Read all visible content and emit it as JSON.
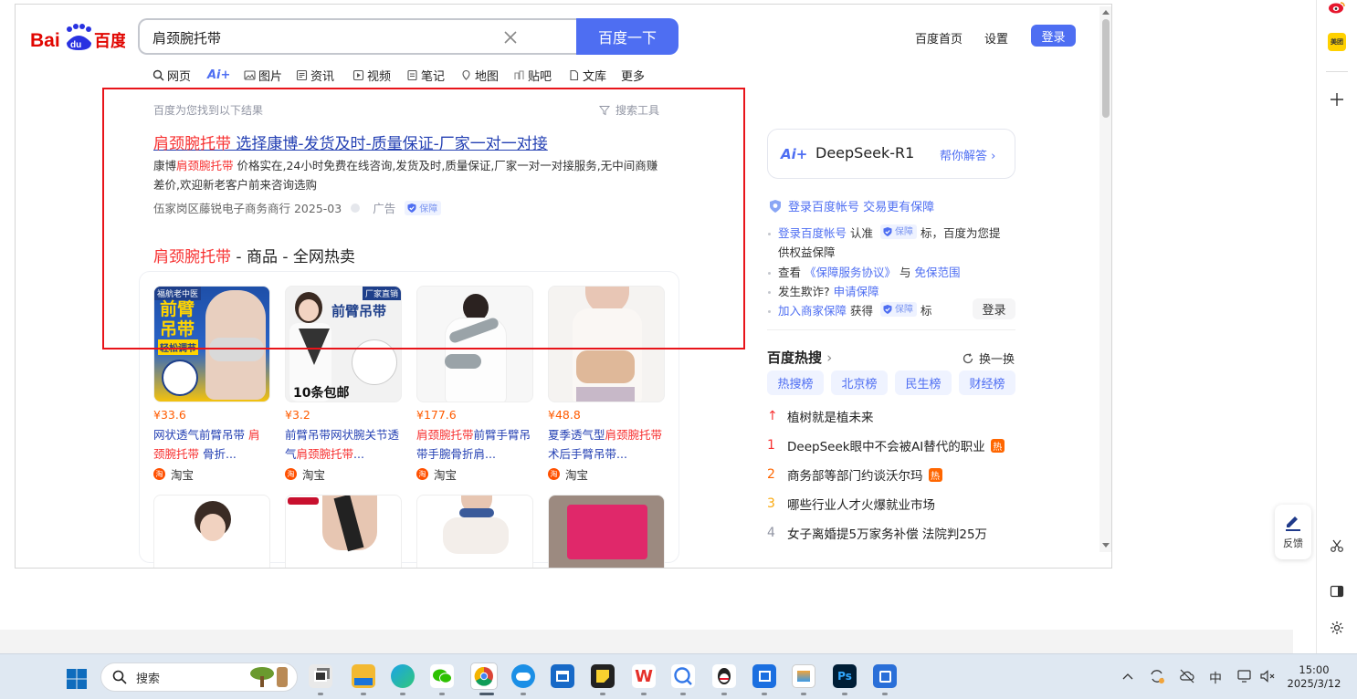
{
  "logo": {
    "text": "Bai",
    "du": "du",
    "cn": "百度"
  },
  "search": {
    "query": "肩颈腕托带",
    "button": "百度一下"
  },
  "header": {
    "home": "百度首页",
    "settings": "设置",
    "login": "登录"
  },
  "tabs": [
    {
      "label": "网页"
    },
    {
      "label": "Ai+"
    },
    {
      "label": "图片"
    },
    {
      "label": "资讯"
    },
    {
      "label": "视频"
    },
    {
      "label": "笔记"
    },
    {
      "label": "地图"
    },
    {
      "label": "贴吧"
    },
    {
      "label": "文库"
    },
    {
      "label": "更多"
    }
  ],
  "results": {
    "count_text": "百度为您找到以下结果",
    "tools": "搜索工具",
    "ad": {
      "title_highlight": "肩颈腕托带",
      "title_rest": " 选择康博-发货及时-质量保证-厂家一对一对接",
      "desc_pre": "康博",
      "desc_highlight": "肩颈腕托带",
      "desc_rest": " 价格实在,24小时免费在线咨询,发货及时,质量保证,厂家一对一对接服务,无中间商赚差价,欢迎新老客户前来咨询选购",
      "source": "伍家岗区藤锐电子商务商行 2025-03",
      "ad_label": "广告",
      "badge": "保障"
    },
    "shop": {
      "title_highlight": "肩颈腕托带",
      "title_rest": " - 商品 - 全网热卖",
      "products": [
        {
          "price": "¥33.6",
          "name_pre": "网状透气前臂吊带 ",
          "name_hl": "肩颈腕托带",
          "name_post": " 骨折...",
          "source": "淘宝",
          "img_text": "前臂\n吊带",
          "img_top": "福航老中医",
          "img_bottom": "轻松调节"
        },
        {
          "price": "¥3.2",
          "name_pre": "前臂吊带网状腕关节透气",
          "name_hl": "肩颈腕托带",
          "name_post": "...",
          "source": "淘宝",
          "img_text": "前臂吊带",
          "img_top": "厂家直销",
          "img_bottom": "10条包邮"
        },
        {
          "price": "¥177.6",
          "name_pre": "",
          "name_hl": "肩颈腕托带",
          "name_post": "前臂手臂吊带手腕骨折肩...",
          "source": "淘宝"
        },
        {
          "price": "¥48.8",
          "name_pre": "夏季透气型",
          "name_hl": "肩颈腕托带",
          "name_post": "术后手臂吊带...",
          "source": "淘宝"
        }
      ]
    }
  },
  "right": {
    "deepseek": {
      "logo": "Ai+",
      "name": "DeepSeek-R1",
      "help": "帮你解答"
    },
    "bao": {
      "head": "登录百度帐号 交易更有保障",
      "line1_blue": "登录百度帐号",
      "line1_mid": " 认准 ",
      "line1_badge": "保障",
      "line1_rest": " 标，百度为您提",
      "line1b": "供权益保障",
      "line2_pre": "查看 ",
      "line2_blue": "《保障服务协议》",
      "line2_mid": " 与 ",
      "line2_blue2": "免保范围",
      "line3_pre": "发生欺诈? ",
      "line3_blue": "申请保障",
      "line4_blue": "加入商家保障",
      "line4_mid": " 获得 ",
      "line4_badge": "保障",
      "line4_rest": " 标",
      "login": "登录"
    },
    "hot": {
      "title": "百度热搜",
      "refresh": "换一换",
      "tabs": [
        "热搜榜",
        "北京榜",
        "民生榜",
        "财经榜"
      ],
      "items": [
        {
          "rank": "↑",
          "text": "植树就是植未来",
          "tag": ""
        },
        {
          "rank": "1",
          "text": "DeepSeek眼中不会被AI替代的职业",
          "tag": "热"
        },
        {
          "rank": "2",
          "text": "商务部等部门约谈沃尔玛",
          "tag": "热"
        },
        {
          "rank": "3",
          "text": "哪些行业人才火爆就业市场",
          "tag": ""
        },
        {
          "rank": "4",
          "text": "女子离婚提5万家务补偿 法院判25万",
          "tag": ""
        }
      ]
    }
  },
  "feedback": "反馈",
  "taskbar": {
    "search": "搜索",
    "time": "15:00",
    "date": "2025/3/12",
    "ime": "中"
  },
  "colors": {
    "accent": "#4e6ef2",
    "highlight": "#f73131",
    "price": "#ff5b00",
    "ad_box": "#e8141a"
  }
}
